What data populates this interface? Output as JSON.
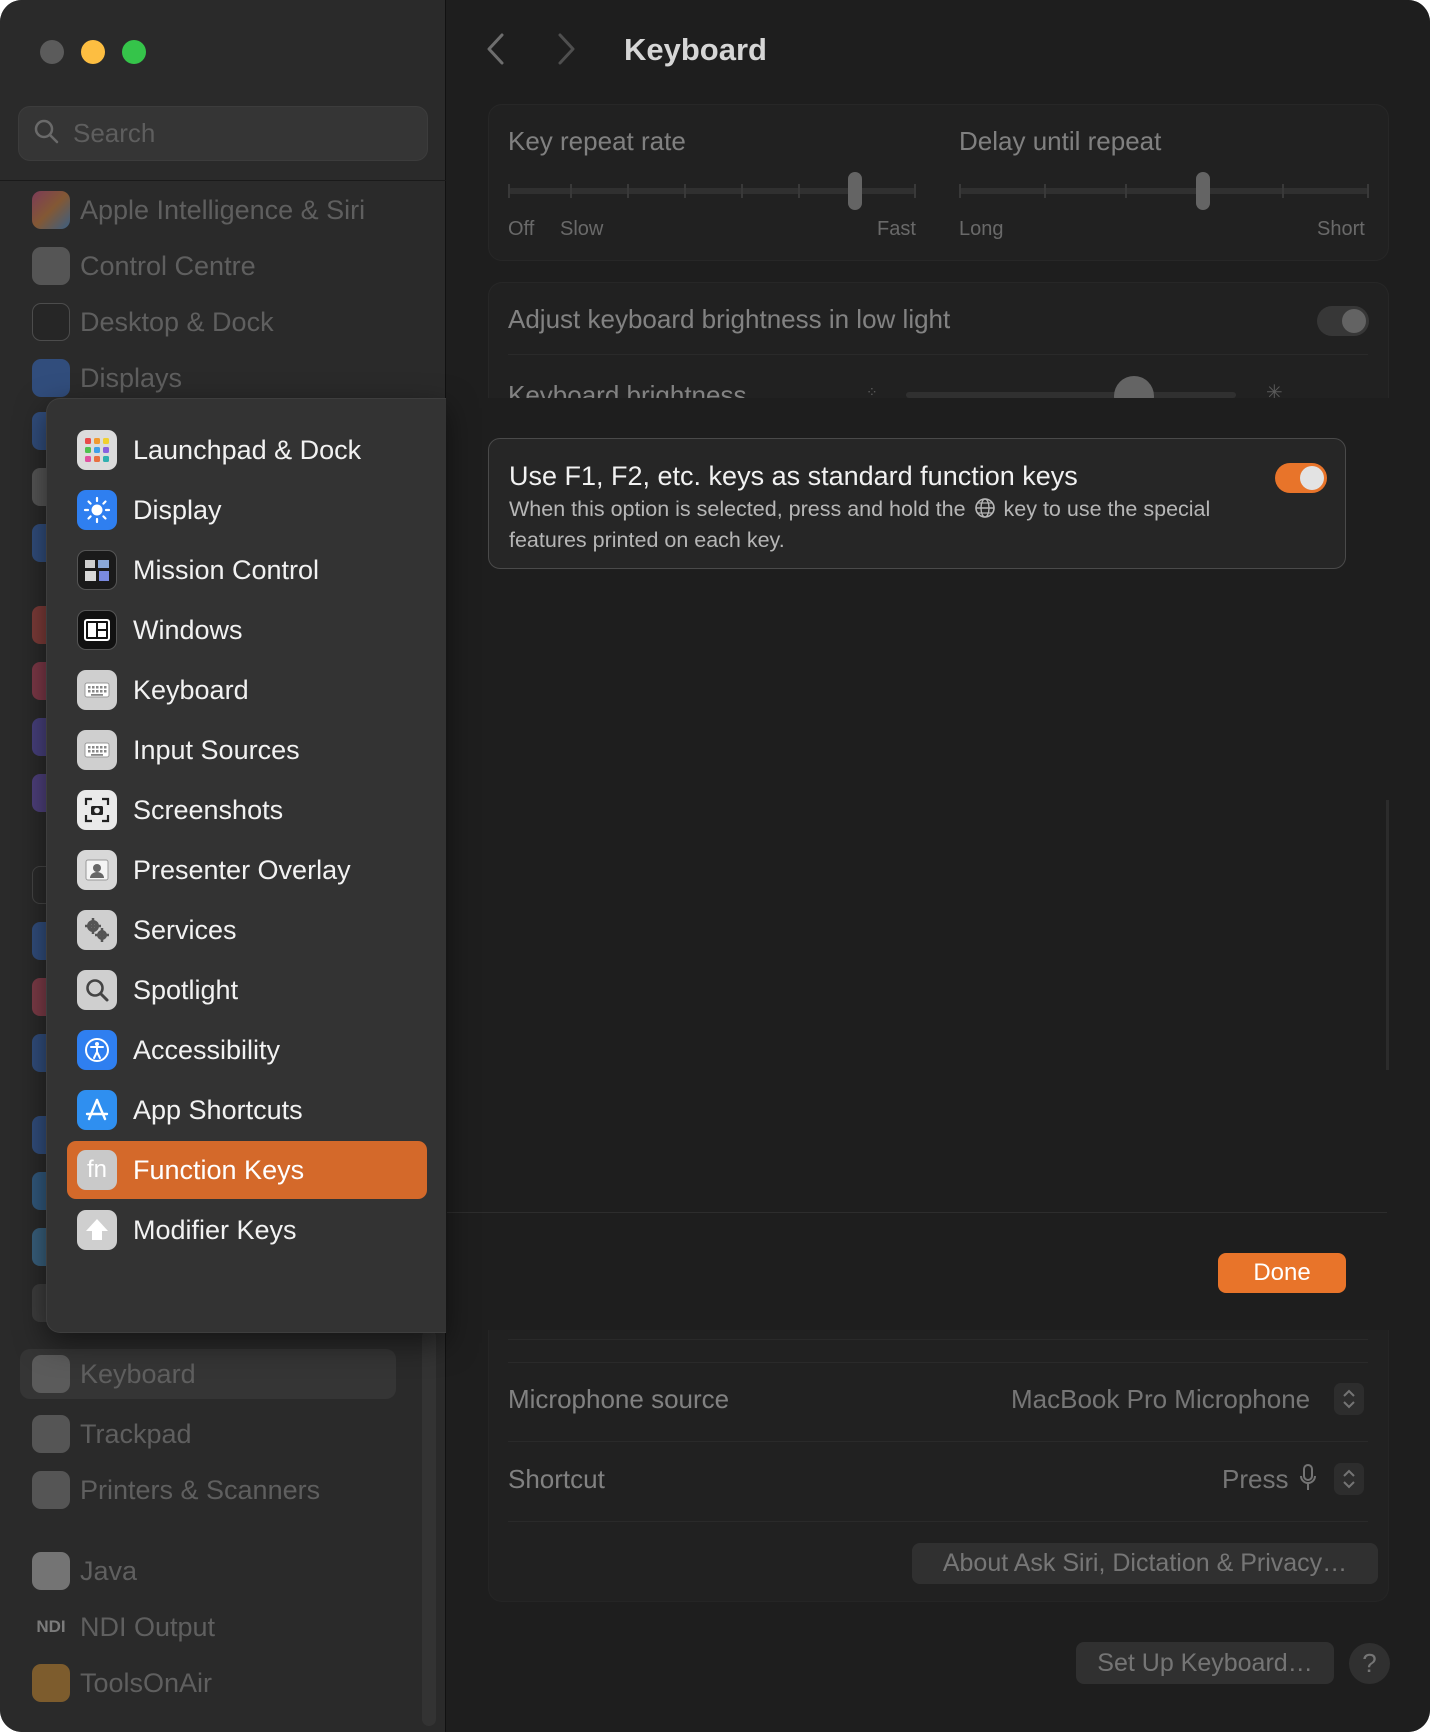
{
  "sidebar": {
    "search_placeholder": "Search",
    "items_top": [
      "Apple Intelligence & Siri",
      "Control Centre",
      "Desktop & Dock",
      "Displays"
    ],
    "items_bottom": [
      "Keyboard",
      "Trackpad",
      "Printers & Scanners",
      "Java",
      "NDI Output",
      "ToolsOnAir"
    ],
    "ndi_badge": "NDI"
  },
  "main": {
    "title": "Keyboard",
    "key_repeat": {
      "label": "Key repeat rate",
      "off": "Off",
      "slow": "Slow",
      "fast": "Fast",
      "level": 0.85
    },
    "delay_repeat": {
      "label": "Delay until repeat",
      "long": "Long",
      "short": "Short",
      "level": 0.6
    },
    "adjust_brightness_label": "Adjust keyboard brightness in low light",
    "keyboard_brightness_label": "Keyboard brightness",
    "microphone_label": "Microphone source",
    "microphone_value": "MacBook Pro Microphone",
    "shortcut_label": "Shortcut",
    "shortcut_value": "Press",
    "about_button": "About Ask Siri, Dictation & Privacy…",
    "setup_button": "Set Up Keyboard…",
    "help_button": "?"
  },
  "sheet": {
    "fn_title": "Use F1, F2, etc. keys as standard function keys",
    "fn_desc_1": "When this option is selected, press and hold the",
    "fn_desc_2": "key to use the special features printed on each key.",
    "fn_enabled": true,
    "done_label": "Done"
  },
  "menu": {
    "items": [
      "Launchpad & Dock",
      "Display",
      "Mission Control",
      "Windows",
      "Keyboard",
      "Input Sources",
      "Screenshots",
      "Presenter Overlay",
      "Services",
      "Spotlight",
      "Accessibility",
      "App Shortcuts",
      "Function Keys",
      "Modifier Keys"
    ],
    "selected": "Function Keys",
    "fn_glyph": "fn"
  },
  "colors": {
    "accent": "#e8742a",
    "selected_item": "#d4692a",
    "window_bg": "#1e1e1e",
    "menu_bg": "#333333"
  }
}
